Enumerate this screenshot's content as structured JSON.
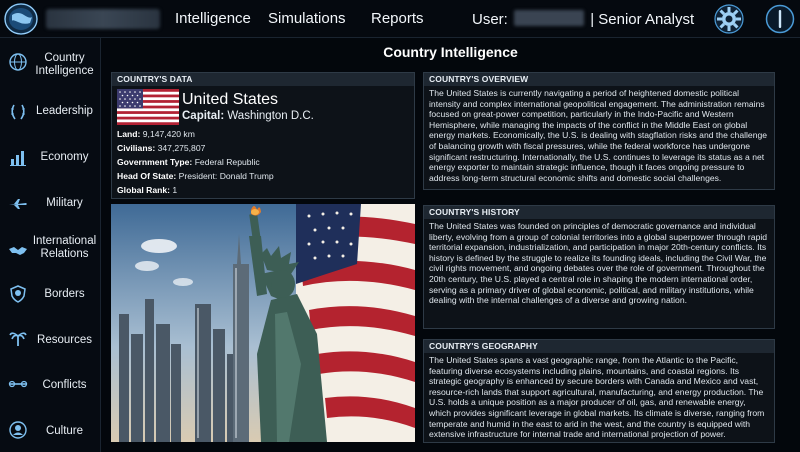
{
  "header": {
    "nav": [
      "Intelligence",
      "Simulations",
      "Reports"
    ],
    "user_label": "User:",
    "user_role": "| Senior Analyst",
    "icons": [
      "globe-logo-icon",
      "gear-icon",
      "power-icon"
    ]
  },
  "sidebar": {
    "items": [
      {
        "label": "Country Intelligence",
        "icon": "globe-icon"
      },
      {
        "label": "Leadership",
        "icon": "laurel-icon"
      },
      {
        "label": "Economy",
        "icon": "chart-icon"
      },
      {
        "label": "Military",
        "icon": "jet-icon"
      },
      {
        "label": "International Relations",
        "icon": "handshake-icon"
      },
      {
        "label": "Borders",
        "icon": "shield-map-icon"
      },
      {
        "label": "Resources",
        "icon": "palm-icon"
      },
      {
        "label": "Conflicts",
        "icon": "swords-icon"
      },
      {
        "label": "Culture",
        "icon": "head-icon"
      }
    ]
  },
  "page": {
    "title": "Country Intelligence"
  },
  "country_data": {
    "heading": "COUNTRY'S DATA",
    "name": "United States",
    "capital_label": "Capital:",
    "capital": "Washington D.C.",
    "facts": [
      {
        "label": "Land:",
        "value": "9,147,420 km"
      },
      {
        "label": "Civilians:",
        "value": "347,275,807"
      },
      {
        "label": "Government Type:",
        "value": "Federal Republic"
      },
      {
        "label": "Head Of State:",
        "value": "President: Donald Trump"
      },
      {
        "label": "Global Rank:",
        "value": "1"
      }
    ]
  },
  "overview": {
    "heading": "COUNTRY'S OVERVIEW",
    "text": "The United States is currently navigating a period of heightened domestic political intensity and complex international geopolitical engagement. The administration remains focused on great-power competition, particularly in the Indo-Pacific and Western Hemisphere, while managing the impacts of the conflict in the Middle East on global energy markets. Economically, the U.S. is dealing with stagflation risks and the challenge of balancing growth with fiscal pressures, while the federal workforce has undergone significant restructuring. Internationally, the U.S. continues to leverage its status as a net energy exporter to maintain strategic influence, though it faces ongoing pressure to address long-term structural economic shifts and domestic social challenges."
  },
  "history": {
    "heading": "COUNTRY'S HISTORY",
    "text": "The United States was founded on principles of democratic governance and individual liberty, evolving from a group of colonial territories into a global superpower through rapid territorial expansion, industrialization, and participation in major 20th-century conflicts. Its history is defined by the struggle to realize its founding ideals, including the Civil War, the civil rights movement, and ongoing debates over the role of government. Throughout the 20th century, the U.S. played a central role in shaping the modern international order, serving as a primary driver of global economic, political, and military institutions, while dealing with the internal challenges of a diverse and growing nation."
  },
  "geography": {
    "heading": "COUNTRY'S GEOGRAPHY",
    "text": "The United States spans a vast geographic range, from the Atlantic to the Pacific, featuring diverse ecosystems including plains, mountains, and coastal regions. Its strategic geography is enhanced by secure borders with Canada and Mexico and vast, resource-rich lands that support agricultural, manufacturing, and energy production. The U.S. holds a unique position as a major producer of oil, gas, and renewable energy, which provides significant leverage in global markets. Its climate is diverse, ranging from temperate and humid in the east to arid in the west, and the country is equipped with extensive infrastructure for internal trade and international projection of power."
  }
}
